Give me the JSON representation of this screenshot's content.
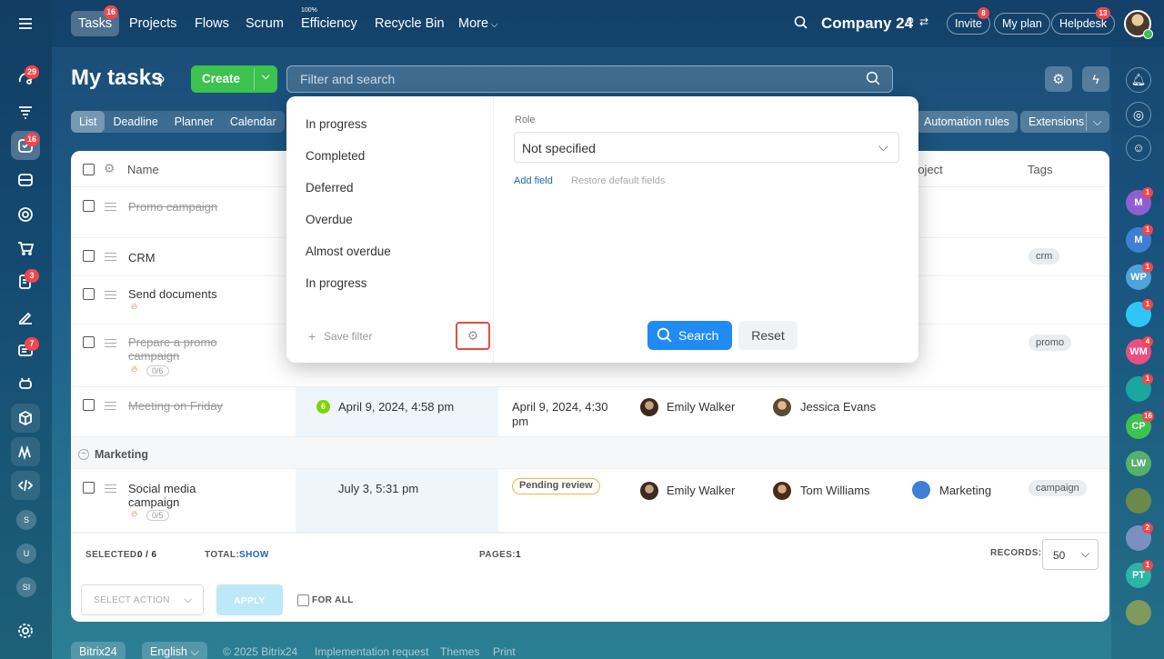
{
  "colors": {
    "accent": "#3bc24f",
    "primary": "#2067b0",
    "badge": "#f3454b",
    "highlight": "#e74c3c"
  },
  "nav": {
    "tasks": "Tasks",
    "tasks_badge": "16",
    "projects": "Projects",
    "flows": "Flows",
    "scrum": "Scrum",
    "efficiency": "Efficiency",
    "efficiency_pct": "100%",
    "recycle": "Recycle Bin",
    "more": "More",
    "company": "Company 24",
    "invite": "Invite",
    "invite_badge": "8",
    "myplan": "My plan",
    "helpdesk": "Helpdesk",
    "helpdesk_badge": "13"
  },
  "left_sidebar": {
    "badges": [
      "29",
      "16",
      "3",
      "7"
    ],
    "avatars": [
      "S",
      "U",
      "SI"
    ]
  },
  "right_sidebar": [
    {
      "label": "M",
      "color": "#8f5fd1",
      "badge": "1"
    },
    {
      "label": "M",
      "color": "#3e7fd6",
      "badge": "1"
    },
    {
      "label": "WP",
      "color": "#4ea3d9",
      "badge": "1"
    },
    {
      "label": "",
      "color": "#2fc6f6",
      "badge": "1"
    },
    {
      "label": "WM",
      "color": "#e94f84",
      "badge": "4"
    },
    {
      "label": "",
      "color": "#18a8a0",
      "badge": "1"
    },
    {
      "label": "CP",
      "color": "#3bc24f",
      "badge": "16"
    },
    {
      "label": "LW",
      "color": "#55b06d",
      "badge": ""
    },
    {
      "label": "",
      "color": "#6b8a4a",
      "badge": ""
    },
    {
      "label": "",
      "color": "#7a90c0",
      "badge": "2"
    },
    {
      "label": "PT",
      "color": "#2db4a3",
      "badge": "1"
    },
    {
      "label": "",
      "color": "#7f9a5a",
      "badge": ""
    }
  ],
  "page": {
    "title": "My tasks",
    "create": "Create",
    "search_placeholder": "Filter and search"
  },
  "views": [
    "List",
    "Deadline",
    "Planner",
    "Calendar"
  ],
  "right_buttons": {
    "automation": "Automation rules",
    "extensions": "Extensions"
  },
  "columns": {
    "name": "Name",
    "project": "roject",
    "tags": "Tags"
  },
  "rows": [
    {
      "name": "Promo campaign",
      "struck": true
    },
    {
      "name": "CRM",
      "struck": false,
      "tag": "crm"
    },
    {
      "name": "Send documents",
      "struck": false
    },
    {
      "name": "Prepare a promo campaign",
      "struck": true,
      "sub": "0/6",
      "tag": "promo"
    },
    {
      "name": "Meeting on Friday",
      "struck": true,
      "deadline": "April 9, 2024, 4:58 pm",
      "deadline_badge": "6",
      "activity": "April 9, 2024, 4:30 pm",
      "creator": "Emily Walker",
      "responsible": "Jessica Evans"
    },
    {
      "name": "Social media campaign",
      "struck": false,
      "sub": "0/5",
      "deadline": "July 3, 5:31 pm",
      "status": "Pending review",
      "creator": "Emily Walker",
      "responsible": "Tom Williams",
      "project": "Marketing",
      "tag": "campaign"
    }
  ],
  "group": "Marketing",
  "footer": {
    "selected_label": "SELECTED:",
    "selected": "0 / 6",
    "total_label": "TOTAL:",
    "total": "SHOW",
    "pages_label": "PAGES:",
    "pages": "1",
    "records_label": "RECORDS:",
    "records": "50",
    "select_action": "SELECT ACTION",
    "apply": "APPLY",
    "for_all": "FOR ALL"
  },
  "popup": {
    "presets": [
      "In progress",
      "Completed",
      "Deferred",
      "Overdue",
      "Almost overdue",
      "In progress"
    ],
    "save_filter": "Save filter",
    "role_label": "Role",
    "role_value": "Not specified",
    "add_field": "Add field",
    "restore": "Restore default fields",
    "search": "Search",
    "reset": "Reset"
  },
  "bottom": {
    "brand": "Bitrix24",
    "language": "English",
    "copyright": "© 2025 Bitrix24",
    "impl": "Implementation request",
    "themes": "Themes",
    "print": "Print"
  }
}
